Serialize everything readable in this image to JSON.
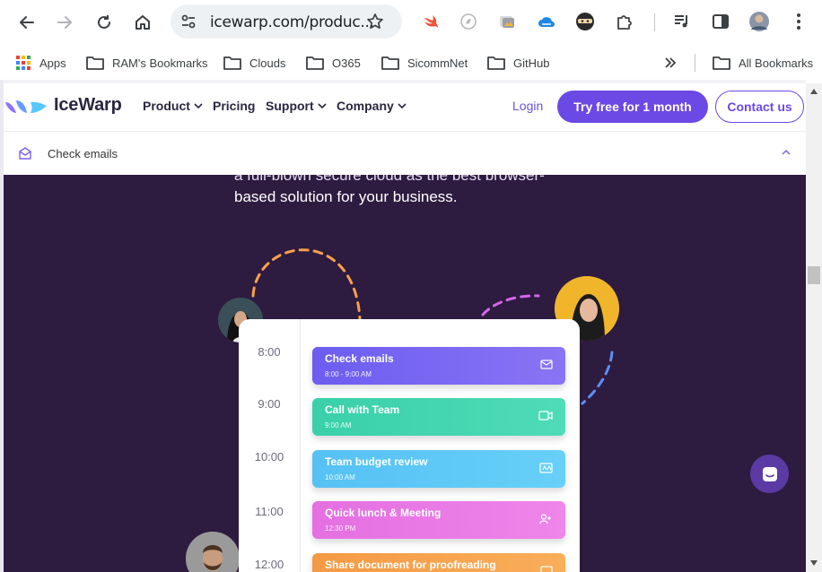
{
  "browser": {
    "url": "icewarp.com/produc...",
    "bookmarks": [
      "Apps",
      "RAM's Bookmarks",
      "Clouds",
      "O365",
      "SicommNet",
      "GitHub"
    ],
    "all_bookmarks": "All Bookmarks"
  },
  "site": {
    "brand": "IceWarp",
    "nav": {
      "product": "Product",
      "pricing": "Pricing",
      "support": "Support",
      "company": "Company"
    },
    "login": "Login",
    "try_free": "Try free for 1 month",
    "contact": "Contact us",
    "subheader_label": "Check emails"
  },
  "hero": {
    "text_line1": "a full-blown secure cloud as the best browser-",
    "text_line2": "based solution for your business."
  },
  "calendar": {
    "hours": [
      "8:00",
      "9:00",
      "10:00",
      "11:00",
      "12:00"
    ],
    "events": [
      {
        "title": "Check emails",
        "time": "8:00 - 9:00 AM",
        "color": "#7462ef",
        "icon": "mail-icon"
      },
      {
        "title": "Call with Team",
        "time": "9:00 AM",
        "color": "#3fd4ae",
        "icon": "video-icon"
      },
      {
        "title": "Team budget review",
        "time": "10:00 AM",
        "color": "#5cc8f6",
        "icon": "message-icon"
      },
      {
        "title": "Quick lunch & Meeting",
        "time": "12:30 PM",
        "color": "#e879e4",
        "icon": "people-icon"
      },
      {
        "title": "Share document for proofreading",
        "time": "",
        "color": "#f7a24a",
        "icon": "document-icon"
      }
    ]
  },
  "colors": {
    "accent": "#6b49e4",
    "hero_bg": "#2e1b40"
  }
}
